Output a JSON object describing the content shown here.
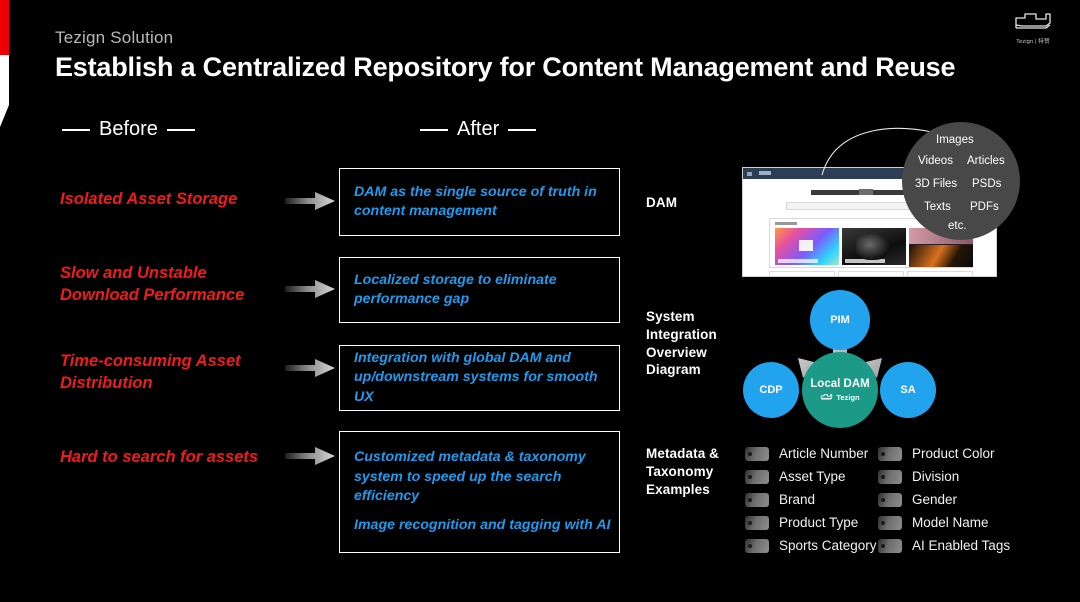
{
  "header": {
    "eyebrow": "Tezign Solution",
    "headline": "Establish a Centralized Repository for Content Management and Reuse",
    "logo_text": "Tezign | 特赞",
    "logo_icon": "tezign-logo-icon"
  },
  "columns": {
    "before_label": "Before",
    "after_label": "After"
  },
  "rows": [
    {
      "before": "Isolated Asset Storage",
      "after": [
        "DAM as the single source of truth in content management"
      ]
    },
    {
      "before": "Slow and Unstable Download Performance",
      "after": [
        "Localized storage to eliminate performance gap"
      ]
    },
    {
      "before": "Time-consuming Asset Distribution",
      "after": [
        "Integration with global DAM and up/downstream systems for smooth UX"
      ]
    },
    {
      "before": "Hard to search for assets",
      "after": [
        "Customized metadata & taxonomy system to speed up the search efficiency",
        "Image recognition and tagging with AI"
      ]
    }
  ],
  "right": {
    "dam_label": "DAM",
    "diagram_label": "System Integration Overview Diagram",
    "metadata_label": "Metadata & Taxonomy Examples",
    "bubble_items": [
      "Images",
      "Videos",
      "Articles",
      "3D Files",
      "PSDs",
      "Texts",
      "PDFs",
      "etc."
    ],
    "diagram_nodes": {
      "top": "PIM",
      "left": "CDP",
      "right": "SA",
      "center": "Local DAM",
      "center_sub": "Tezign"
    },
    "metadata_left": [
      "Article Number",
      "Asset Type",
      "Brand",
      "Product Type",
      "Sports Category"
    ],
    "metadata_right": [
      "Product Color",
      "Division",
      "Gender",
      "Model Name",
      "AI Enabled Tags"
    ]
  },
  "colors": {
    "background": "#000000",
    "accent_red": "#ec0000",
    "before_text": "#f01b1b",
    "after_text": "#1f9bee",
    "node_blue": "#22a3ee",
    "node_green": "#1b9b87",
    "bubble_gray": "#484848"
  }
}
